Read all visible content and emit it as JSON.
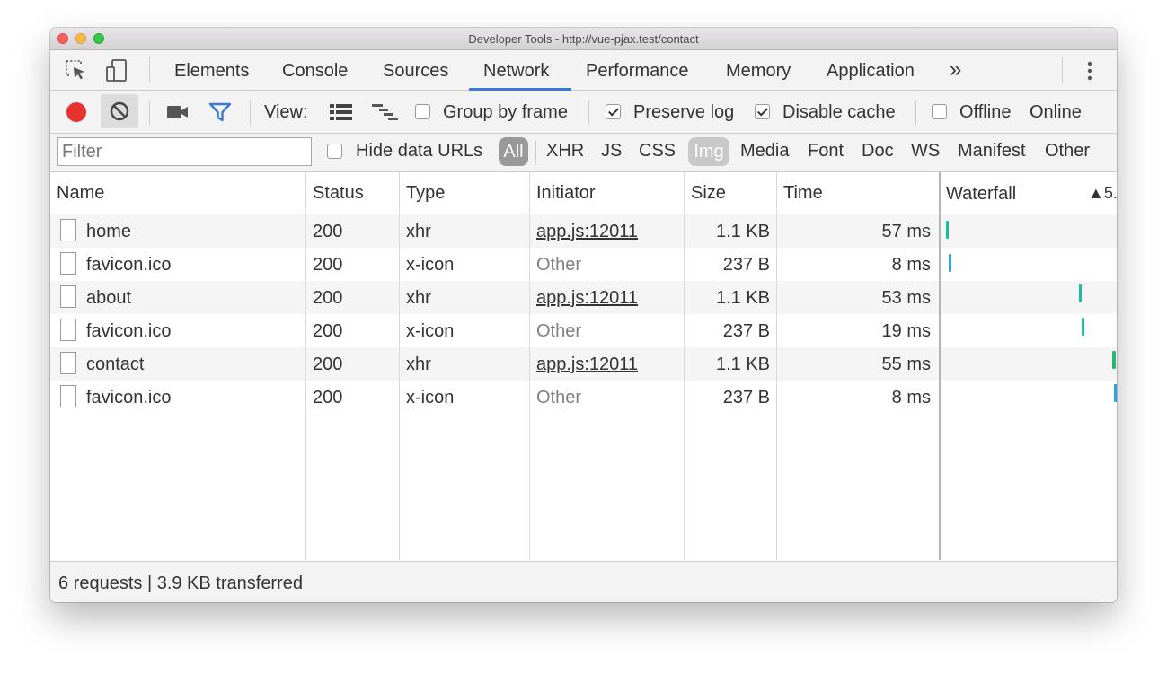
{
  "window": {
    "title": "Developer Tools - http://vue-pjax.test/contact"
  },
  "tabs": [
    {
      "label": "Elements"
    },
    {
      "label": "Console"
    },
    {
      "label": "Sources"
    },
    {
      "label": "Network",
      "active": true
    },
    {
      "label": "Performance"
    },
    {
      "label": "Memory"
    },
    {
      "label": "Application"
    }
  ],
  "icons": {
    "inspect": "cursor-select-icon",
    "device": "device-toolbar-icon",
    "more_tabs": "chevron-double-right-icon",
    "kebab": "vertical-dots-icon",
    "record": "record-icon",
    "clear": "clear-icon",
    "capture": "video-camera-icon",
    "filter": "filter-funnel-icon",
    "large_rows": "list-view-icon",
    "overview": "waterfall-overview-icon"
  },
  "colors": {
    "record": "#e8322f",
    "filter_accent": "#3879d9",
    "tab_active": "#3879d9",
    "pill_all": "#999999",
    "pill_img": "#c8c8c8",
    "wf_teal": "#1dbb9b",
    "wf_blue": "#2aa5e4",
    "wf_green": "#2bb673"
  },
  "toolbar": {
    "more_tabs_glyph": "»",
    "view_label": "View:",
    "group_by_frame": {
      "label": "Group by frame",
      "checked": false
    },
    "preserve_log": {
      "label": "Preserve log",
      "checked": true
    },
    "disable_cache": {
      "label": "Disable cache",
      "checked": true
    },
    "offline": {
      "label": "Offline",
      "checked": false
    },
    "throttle": "Online"
  },
  "filter": {
    "placeholder": "Filter",
    "hide_data_urls": {
      "label": "Hide data URLs",
      "checked": false
    },
    "types": [
      "All",
      "XHR",
      "JS",
      "CSS",
      "Img",
      "Media",
      "Font",
      "Doc",
      "WS",
      "Manifest",
      "Other"
    ],
    "selected": [
      "All",
      "Img"
    ]
  },
  "table": {
    "columns": [
      "Name",
      "Status",
      "Type",
      "Initiator",
      "Size",
      "Time"
    ],
    "waterfall_label": "Waterfall",
    "waterfall_sort": "▲5.",
    "rows": [
      {
        "name": "home",
        "status": "200",
        "type": "xhr",
        "initiator": "app.js:12011",
        "initiator_link": true,
        "size": "1.1 KB",
        "time": "57 ms",
        "wf_color": "#1dbb9b"
      },
      {
        "name": "favicon.ico",
        "status": "200",
        "type": "x-icon",
        "initiator": "Other",
        "initiator_link": false,
        "size": "237 B",
        "time": "8 ms",
        "wf_color": "#2aa5e4"
      },
      {
        "name": "about",
        "status": "200",
        "type": "xhr",
        "initiator": "app.js:12011",
        "initiator_link": true,
        "size": "1.1 KB",
        "time": "53 ms",
        "wf_color": "#1dbb9b"
      },
      {
        "name": "favicon.ico",
        "status": "200",
        "type": "x-icon",
        "initiator": "Other",
        "initiator_link": false,
        "size": "237 B",
        "time": "19 ms",
        "wf_color": "#1dbb9b"
      },
      {
        "name": "contact",
        "status": "200",
        "type": "xhr",
        "initiator": "app.js:12011",
        "initiator_link": true,
        "size": "1.1 KB",
        "time": "55 ms",
        "wf_color": "#2bb673"
      },
      {
        "name": "favicon.ico",
        "status": "200",
        "type": "x-icon",
        "initiator": "Other",
        "initiator_link": false,
        "size": "237 B",
        "time": "8 ms",
        "wf_color": "#2aa5e4"
      }
    ]
  },
  "status": {
    "summary": "6 requests | 3.9 KB transferred"
  }
}
